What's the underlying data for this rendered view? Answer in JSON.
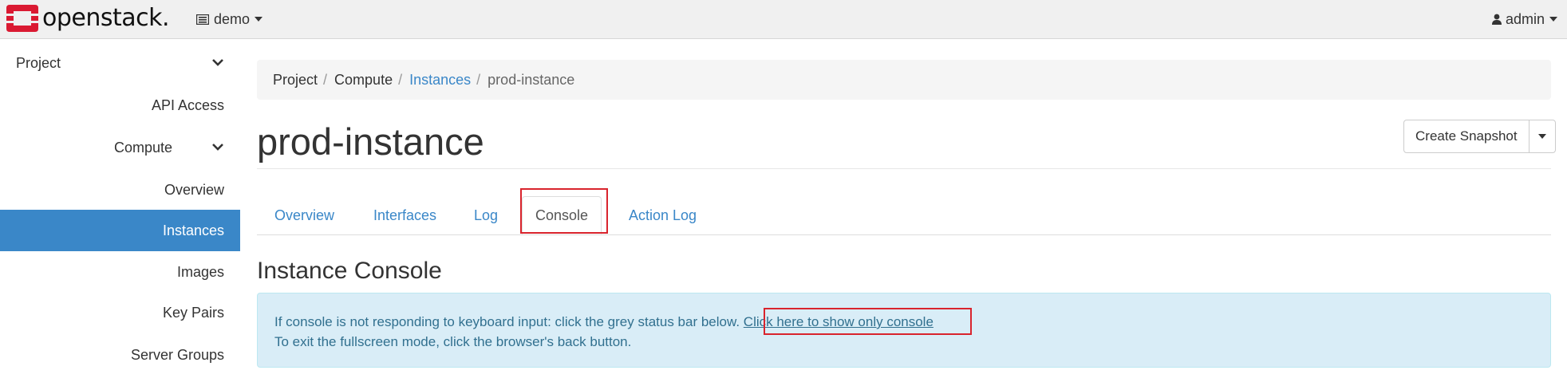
{
  "colors": {
    "accent": "#3a87c8",
    "logo_red": "#da1a32",
    "highlight_red": "#d9242d",
    "info_bg": "#d9edf7",
    "info_text": "#31708f"
  },
  "topbar": {
    "logo_text": "openstack.",
    "project_switcher": {
      "icon": "project-list-icon",
      "label": "demo"
    },
    "user_menu": {
      "icon": "user-icon",
      "label": "admin"
    }
  },
  "sidebar": {
    "project_label": "Project",
    "api_access_label": "API Access",
    "compute_label": "Compute",
    "items": [
      {
        "label": "Overview",
        "active": false
      },
      {
        "label": "Instances",
        "active": true
      },
      {
        "label": "Images",
        "active": false
      },
      {
        "label": "Key Pairs",
        "active": false
      },
      {
        "label": "Server Groups",
        "active": false
      }
    ]
  },
  "breadcrumb": {
    "items": [
      "Project",
      "Compute",
      "Instances",
      "prod-instance"
    ],
    "separator": "/"
  },
  "page": {
    "title": "prod-instance",
    "snapshot_button_label": "Create Snapshot"
  },
  "tabs": [
    {
      "label": "Overview",
      "active": false
    },
    {
      "label": "Interfaces",
      "active": false
    },
    {
      "label": "Log",
      "active": false
    },
    {
      "label": "Console",
      "active": true
    },
    {
      "label": "Action Log",
      "active": false
    }
  ],
  "console": {
    "section_title": "Instance Console",
    "info_text": "If console is not responding to keyboard input: click the grey status bar below.",
    "info_link": "Click here to show only console",
    "info_line2": "To exit the fullscreen mode, click the browser's back button."
  }
}
